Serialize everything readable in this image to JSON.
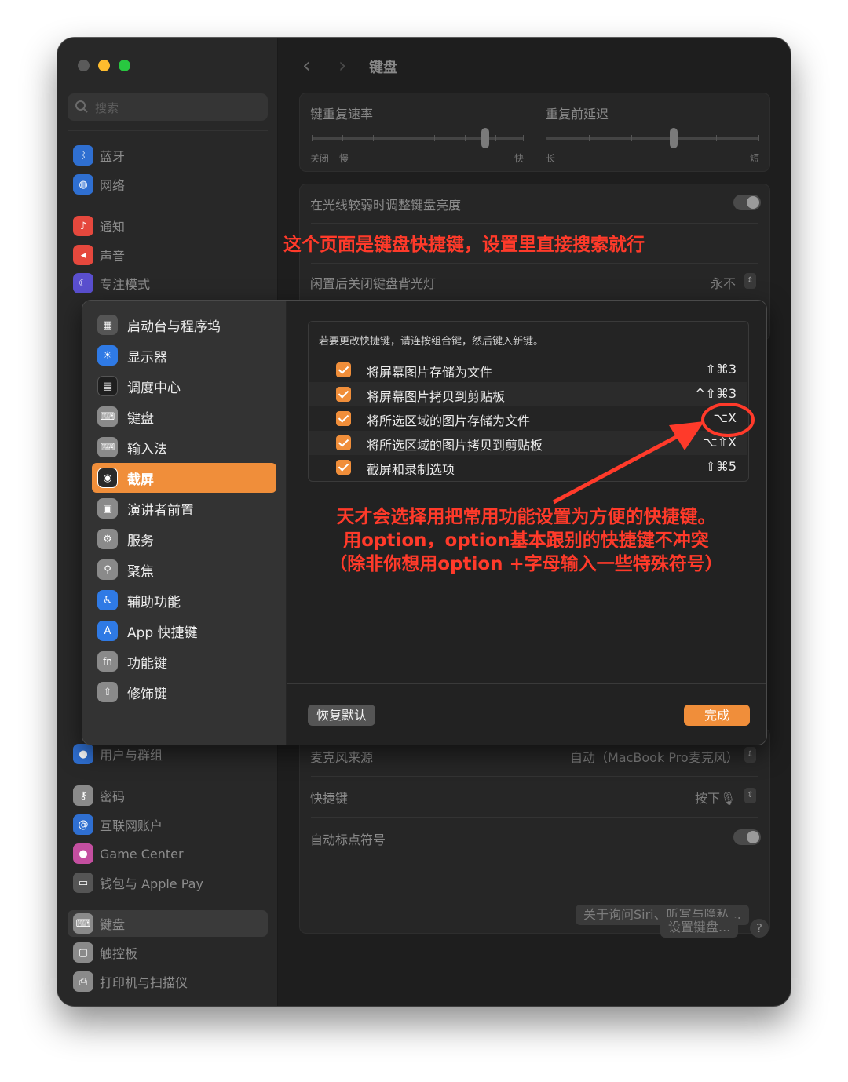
{
  "window": {
    "title": "键盘"
  },
  "search": {
    "placeholder": "搜索"
  },
  "sidebar": {
    "items": [
      {
        "label": "蓝牙",
        "icon": "bluetooth-icon",
        "color": "#2f6fd1"
      },
      {
        "label": "网络",
        "icon": "globe-icon",
        "color": "#2f6fd1"
      },
      {
        "label": "通知",
        "icon": "bell-icon",
        "color": "#e5483d"
      },
      {
        "label": "声音",
        "icon": "speaker-icon",
        "color": "#e5483d"
      },
      {
        "label": "专注模式",
        "icon": "moon-icon",
        "color": "#5a4fcf"
      },
      {
        "label": "用户与群组",
        "icon": "users-icon",
        "color": "#2f6fd1"
      },
      {
        "label": "密码",
        "icon": "key-icon",
        "color": "#8a8a8a"
      },
      {
        "label": "互联网账户",
        "icon": "at-icon",
        "color": "#2f6fd1"
      },
      {
        "label": "Game Center",
        "icon": "game-center-icon",
        "color": "#c44fa0"
      },
      {
        "label": "钱包与 Apple Pay",
        "icon": "wallet-icon",
        "color": "#555555"
      },
      {
        "label": "键盘",
        "icon": "keyboard-icon",
        "color": "#8a8a8a"
      },
      {
        "label": "触控板",
        "icon": "trackpad-icon",
        "color": "#8a8a8a"
      },
      {
        "label": "打印机与扫描仪",
        "icon": "printer-icon",
        "color": "#8a8a8a"
      }
    ]
  },
  "keyboard": {
    "repeat_rate_label": "键重复速率",
    "repeat_rate_left": "关闭",
    "repeat_rate_slow": "慢",
    "repeat_rate_fast": "快",
    "repeat_rate_level": 0.82,
    "delay_label": "重复前延迟",
    "delay_long": "长",
    "delay_short": "短",
    "delay_level": 0.6,
    "brightness_label": "在光线较弱时调整键盘亮度",
    "backlight_off_label": "闲置后关闭键盘背光灯",
    "backlight_off_value": "永不"
  },
  "dictation": {
    "mic_label": "麦克风来源",
    "mic_value": "自动（MacBook Pro麦克风）",
    "shortcut_label": "快捷键",
    "shortcut_value": "按下🎙",
    "punct_label": "自动标点符号",
    "privacy_button": "关于询问Siri、听写与隐私...",
    "setup_keyboard_button": "设置键盘...",
    "help": "?"
  },
  "sheet": {
    "categories": [
      {
        "label": "启动台与程序坞",
        "icon": "launchpad-icon",
        "color": "#555555"
      },
      {
        "label": "显示器",
        "icon": "display-icon",
        "color": "#2f7ae5"
      },
      {
        "label": "调度中心",
        "icon": "mission-control-icon",
        "color": "#1f1f1f"
      },
      {
        "label": "键盘",
        "icon": "keyboard-icon",
        "color": "#8a8a8a"
      },
      {
        "label": "输入法",
        "icon": "input-method-icon",
        "color": "#8a8a8a"
      },
      {
        "label": "截屏",
        "icon": "screenshot-icon",
        "color": "#2a2a2a",
        "active": true
      },
      {
        "label": "演讲者前置",
        "icon": "presenter-icon",
        "color": "#8a8a8a"
      },
      {
        "label": "服务",
        "icon": "gears-icon",
        "color": "#8a8a8a"
      },
      {
        "label": "聚焦",
        "icon": "spotlight-icon",
        "color": "#8a8a8a"
      },
      {
        "label": "辅助功能",
        "icon": "accessibility-icon",
        "color": "#2f7ae5"
      },
      {
        "label": "App 快捷键",
        "icon": "app-store-icon",
        "color": "#2f7ae5"
      },
      {
        "label": "功能键",
        "icon": "fn-icon",
        "color": "#8a8a8a"
      },
      {
        "label": "修饰键",
        "icon": "modifier-icon",
        "color": "#8a8a8a"
      }
    ],
    "hint": "若要更改快捷键，请连按组合键，然后键入新键。",
    "shortcuts": [
      {
        "label": "将屏幕图片存储为文件",
        "keys": "⇧⌘3",
        "checked": true
      },
      {
        "label": "将屏幕图片拷贝到剪贴板",
        "keys": "^⇧⌘3",
        "checked": true
      },
      {
        "label": "将所选区域的图片存储为文件",
        "keys": "⌥X",
        "checked": true
      },
      {
        "label": "将所选区域的图片拷贝到剪贴板",
        "keys": "⌥⇧X",
        "checked": true
      },
      {
        "label": "截屏和录制选项",
        "keys": "⇧⌘5",
        "checked": true
      }
    ],
    "restore_button": "恢复默认",
    "done_button": "完成"
  },
  "annotations": {
    "top": "这个页面是键盘快捷键，设置里直接搜索就行",
    "body_line1": "天才会选择用把常用功能设置为方便的快捷键。",
    "body_line2": "用option，option基本跟别的快捷键不冲突",
    "body_line3": "（除非你想用option +字母输入一些特殊符号）",
    "color": "#ff3a2a"
  }
}
